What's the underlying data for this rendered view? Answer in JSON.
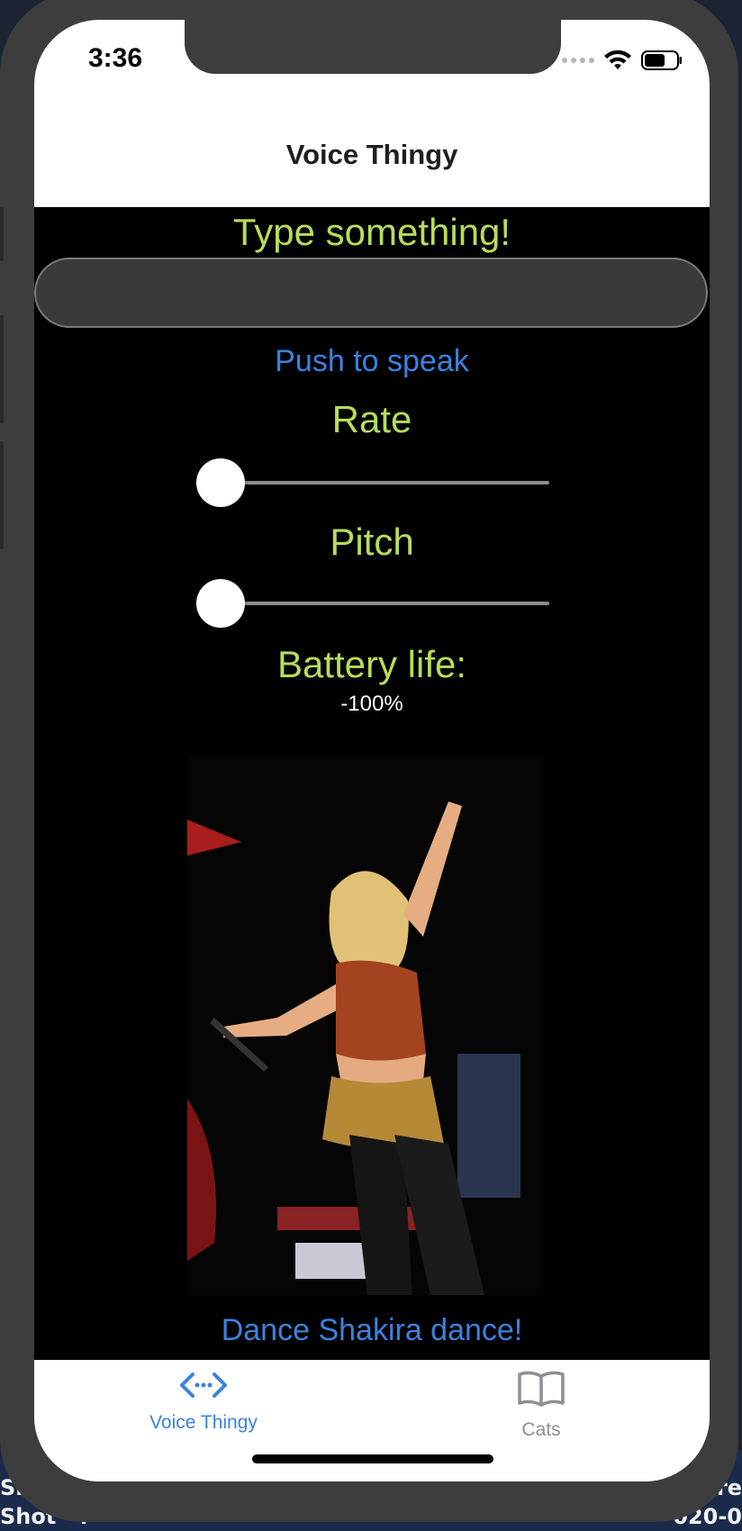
{
  "status_bar": {
    "time": "3:36"
  },
  "nav": {
    "title": "Voice Thingy"
  },
  "main": {
    "type_label": "Type something!",
    "text_input_value": "",
    "speak_button": "Push to speak",
    "rate_label": "Rate",
    "rate_value": 0,
    "pitch_label": "Pitch",
    "pitch_value": 0,
    "battery_label": "Battery life:",
    "battery_value": "-100%",
    "dance_button": "Dance Shakira dance!"
  },
  "tabs": [
    {
      "label": "Voice Thingy",
      "icon": "code-arrows-icon",
      "selected": true
    },
    {
      "label": "Cats",
      "icon": "book-icon",
      "selected": false
    }
  ],
  "desktop_fragments": {
    "left_top": "Si",
    "left_bottom": "Shot - i",
    "right_top": "cre",
    "right_bottom": "020-0"
  },
  "colors": {
    "accent_blue": "#3b82e0",
    "label_green": "#b6de5a",
    "content_bg": "#000000",
    "tab_inactive": "#8e8e93"
  }
}
